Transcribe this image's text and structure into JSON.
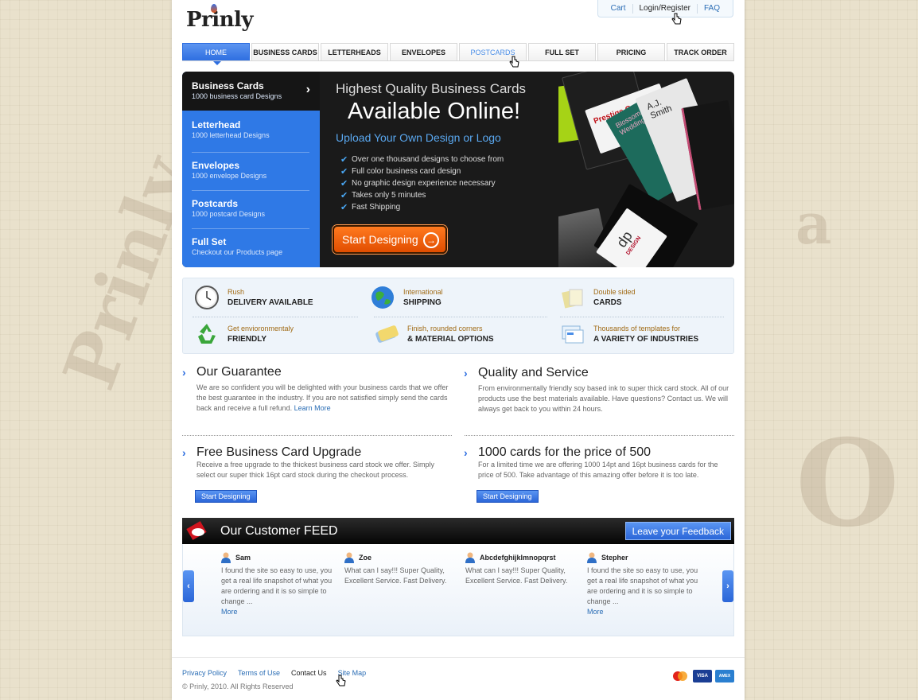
{
  "brand": {
    "logo_text": "Prinly"
  },
  "toplinks": {
    "cart": "Cart",
    "login": "Login/Register",
    "faq": "FAQ"
  },
  "nav": {
    "items": [
      "HOME",
      "BUSINESS CARDS",
      "LETTERHEADS",
      "ENVELOPES",
      "POSTCARDS",
      "FULL SET",
      "PRICING",
      "TRACK ORDER"
    ],
    "active_index": 0,
    "hover_index": 4
  },
  "hero": {
    "sidebar": [
      {
        "title": "Business Cards",
        "subtitle": "1000 business card Designs"
      },
      {
        "title": "Letterhead",
        "subtitle": "1000 letterhead Designs"
      },
      {
        "title": "Envelopes",
        "subtitle": "1000 envelope Designs"
      },
      {
        "title": "Postcards",
        "subtitle": "1000 postcard Designs"
      },
      {
        "title": "Full Set",
        "subtitle": "Checkout our Products page"
      }
    ],
    "headline_small": "Highest Quality Business Cards",
    "headline_big": "Available Online!",
    "headline_sub": "Upload Your Own Design or Logo",
    "bullets": [
      "Over one thousand designs to choose from",
      "Full color business card design",
      "No graphic design experience necessary",
      "Takes only 5 minutes",
      "Fast Shipping"
    ],
    "cta": "Start Designing",
    "card_texts": [
      "Prestige Car Hire",
      "Blossom Weddings",
      "A.J. Smith",
      "dp",
      "DESIGN"
    ]
  },
  "features": [
    {
      "line1": "Rush",
      "line2": "DELIVERY AVAILABLE",
      "icon": "clock-icon"
    },
    {
      "line1": "International",
      "line2": "SHIPPING",
      "icon": "globe-icon"
    },
    {
      "line1": "Double sided",
      "line2": "CARDS",
      "icon": "cards-icon"
    },
    {
      "line1": "Get envioronmentaly",
      "line2": "FRIENDLY",
      "icon": "recycle-icon"
    },
    {
      "line1": "Finish, rounded corners",
      "line2": "& MATERIAL OPTIONS",
      "icon": "material-icon"
    },
    {
      "line1": "Thousands of templates for",
      "line2": "A VARIETY OF INDUSTRIES",
      "icon": "templates-icon"
    }
  ],
  "blocks": {
    "guarantee": {
      "title": "Our Guarantee",
      "text": "We are so confident you will be delighted with your business cards that we offer the best guarantee in the industry.  If you are not satisfied simply send the cards back and receive a full refund. ",
      "link": "Learn More"
    },
    "quality": {
      "title": "Quality and Service",
      "text": "From environmentally friendly soy based ink to super thick card stock.  All of our products use the best materials available.  Have questions?  Contact us.  We will always get back to you within 24 hours."
    },
    "upgrade": {
      "title": "Free Business Card Upgrade",
      "text": "Receive a free upgrade to the thickest business card stock we offer.  Simply select our super thick 16pt card stock during the checkout process.",
      "button": "Start Designing"
    },
    "offer": {
      "title": "1000 cards for the price of 500",
      "text": "For a limited time we are offering 1000 14pt and 16pt business cards for the price of 500. Take advantage of this amazing offer before it is too late.",
      "button": "Start Designing"
    }
  },
  "feed": {
    "title": "Our Customer FEED",
    "button": "Leave your Feedback",
    "reviews": [
      {
        "name": "Sam",
        "text": "I found the site so easy to use, you get a real life snapshot of what you are ordering and it is so simple to change ...",
        "more": "More"
      },
      {
        "name": "Zoe",
        "text": "What can I say!!! Super Quality, Excellent Service. Fast Delivery.",
        "more": ""
      },
      {
        "name": "Abcdefghijklmnopqrst",
        "text": "What can I say!!! Super Quality, Excellent Service. Fast Delivery.",
        "more": ""
      },
      {
        "name": "Stepher",
        "text": "I found the site so easy to use, you get a real life snapshot of what you are ordering and it is so simple to change ...",
        "more": "More"
      }
    ]
  },
  "footer": {
    "links": [
      "Privacy Policy",
      "Terms of Use",
      "Contact Us",
      "Site Map"
    ],
    "copyright": "© Prinly, 2010. All Rights Reserved",
    "payments": [
      "MasterCard",
      "VISA",
      "AMEX"
    ]
  },
  "colors": {
    "accent": "#2f79e6",
    "cta": "#f06410",
    "dark": "#1a1a1a"
  }
}
